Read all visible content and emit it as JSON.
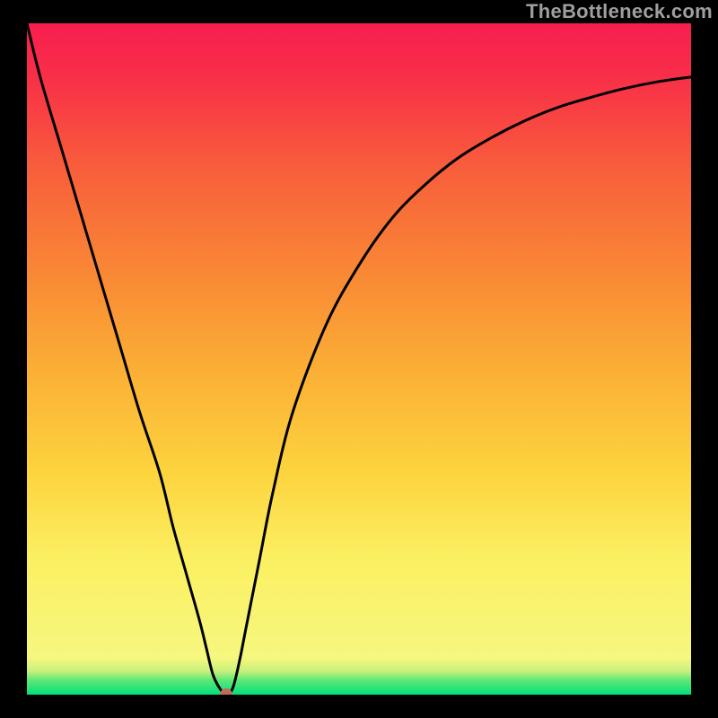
{
  "attribution": "TheBottleneck.com",
  "chart_data": {
    "type": "line",
    "title": "",
    "xlabel": "",
    "ylabel": "",
    "xlim": [
      0,
      100
    ],
    "ylim": [
      0,
      100
    ],
    "x": [
      0,
      2,
      5,
      8,
      11,
      14,
      17,
      20,
      22,
      24,
      26,
      27,
      28,
      29,
      30,
      31,
      32,
      33,
      35,
      37,
      40,
      45,
      50,
      55,
      60,
      65,
      70,
      75,
      80,
      85,
      90,
      95,
      100
    ],
    "values": [
      100,
      92,
      82,
      72,
      62,
      52,
      42,
      33,
      25,
      18,
      11,
      7,
      3,
      1,
      0,
      1,
      5,
      10,
      20,
      30,
      42,
      55,
      64,
      71,
      76,
      80,
      83,
      85.5,
      87.5,
      89,
      90.3,
      91.3,
      92
    ],
    "annotations": [
      {
        "type": "point",
        "x": 30,
        "y": 0,
        "color": "#c26a5a"
      }
    ],
    "gradient_bands_bottom_to_top": [
      {
        "color": "#00e07a",
        "stop": 0.0
      },
      {
        "color": "#60e878",
        "stop": 0.022
      },
      {
        "color": "#c8f07c",
        "stop": 0.035
      },
      {
        "color": "#f6f77f",
        "stop": 0.055
      },
      {
        "color": "#fbf062",
        "stop": 0.2
      },
      {
        "color": "#fdd43e",
        "stop": 0.33
      },
      {
        "color": "#fbb035",
        "stop": 0.48
      },
      {
        "color": "#f98a35",
        "stop": 0.62
      },
      {
        "color": "#f85f3b",
        "stop": 0.78
      },
      {
        "color": "#f82f48",
        "stop": 0.92
      },
      {
        "color": "#f71e4f",
        "stop": 1.0
      }
    ]
  }
}
